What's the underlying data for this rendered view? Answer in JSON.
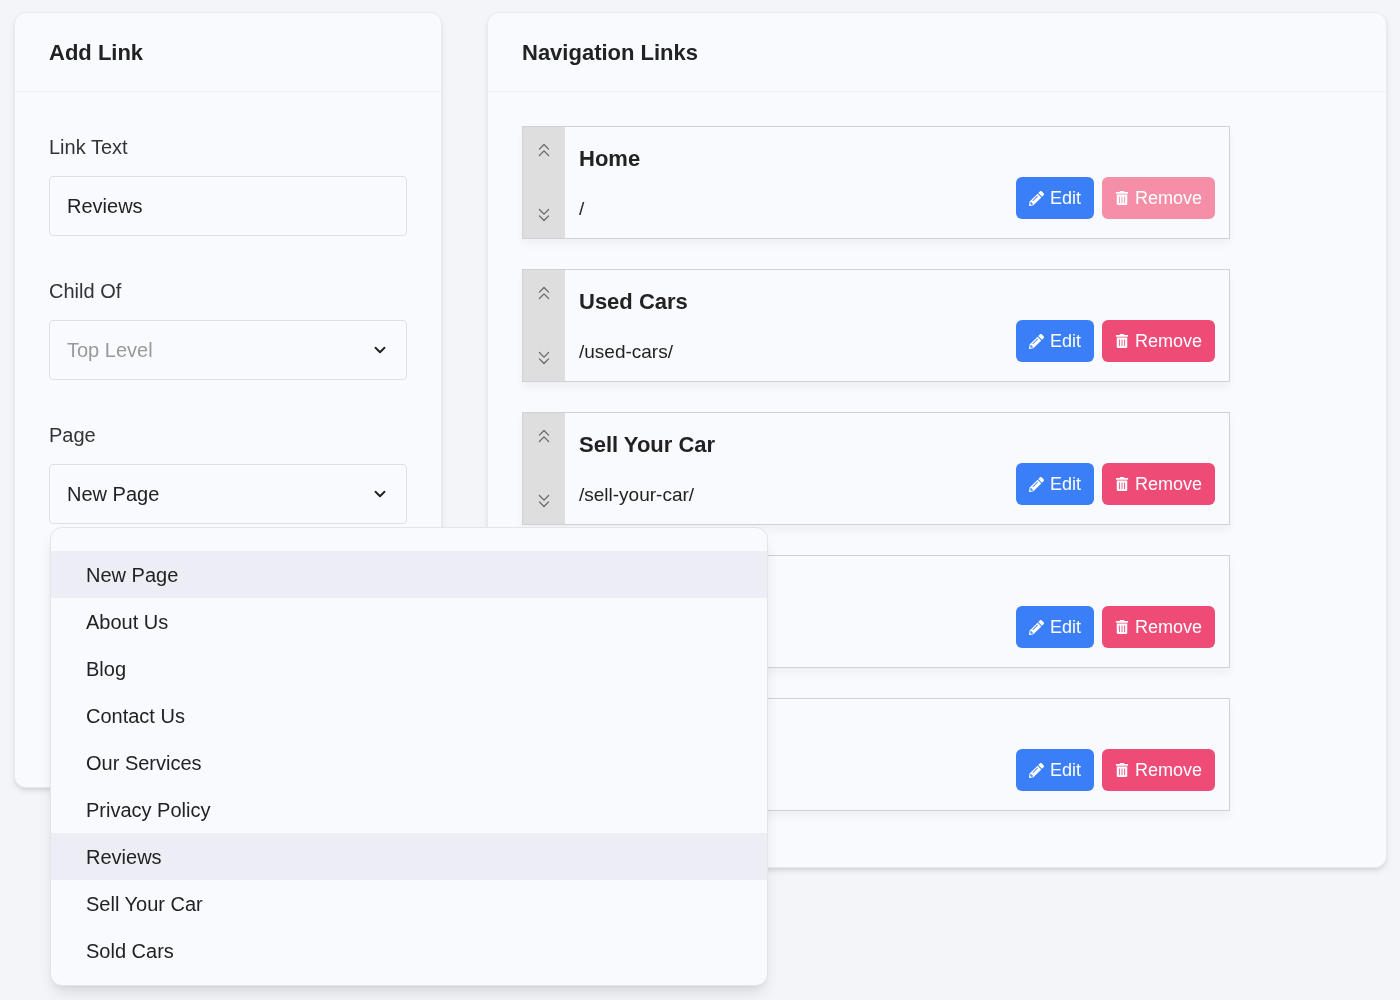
{
  "add_link": {
    "title": "Add Link",
    "fields": [
      {
        "kind": "text",
        "label": "Link Text",
        "value": "Reviews"
      },
      {
        "kind": "select",
        "label": "Child Of",
        "placeholder": "Top Level"
      },
      {
        "kind": "select",
        "label": "Page",
        "value": "New Page"
      }
    ]
  },
  "navigation": {
    "title": "Navigation Links",
    "items": [
      {
        "title": "Home",
        "url": "/",
        "edit": "Edit",
        "remove": "Remove",
        "remove_disabled": true
      },
      {
        "title": "Used Cars",
        "url": "/used-cars/",
        "edit": "Edit",
        "remove": "Remove",
        "remove_disabled": false
      },
      {
        "title": "Sell Your Car",
        "url": "/sell-your-car/",
        "edit": "Edit",
        "remove": "Remove",
        "remove_disabled": false
      },
      {
        "edit": "Edit",
        "remove": "Remove",
        "remove_disabled": false
      },
      {
        "edit": "Edit",
        "remove": "Remove",
        "remove_disabled": false
      }
    ]
  },
  "page_dropdown": {
    "options": [
      {
        "label": "New Page",
        "highlighted": true
      },
      {
        "label": "About Us",
        "highlighted": false
      },
      {
        "label": "Blog",
        "highlighted": false
      },
      {
        "label": "Contact Us",
        "highlighted": false
      },
      {
        "label": "Our Services",
        "highlighted": false
      },
      {
        "label": "Privacy Policy",
        "highlighted": false
      },
      {
        "label": "Reviews",
        "highlighted": true
      },
      {
        "label": "Sell Your Car",
        "highlighted": false
      },
      {
        "label": "Sold Cars",
        "highlighted": false
      }
    ]
  }
}
